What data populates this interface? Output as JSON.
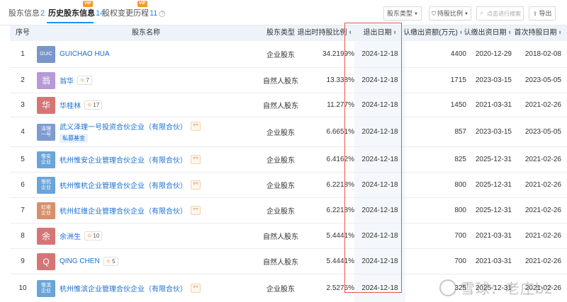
{
  "tabs": [
    {
      "label": "股东信息",
      "count": "2",
      "active": false,
      "vip": false
    },
    {
      "label": "历史股东信息",
      "count": "14",
      "active": true,
      "vip": true
    },
    {
      "label": "股权变更历程",
      "count": "11",
      "active": false,
      "vip": true
    }
  ],
  "vip_label": "VIP",
  "toolbar": {
    "shareholder_type": "股东类型",
    "holding_ratio": "持股比例",
    "search_placeholder": "点击进行搜索",
    "export": "导出"
  },
  "columns": {
    "idx": "序号",
    "name": "股东名称",
    "type": "股东类型",
    "ratio": "退出时持股比例",
    "exit_date": "退出日期",
    "amount": "认缴出资额(万元)",
    "sub_date": "认缴出资日期",
    "first_date": "首次持股日期"
  },
  "rows": [
    {
      "idx": "1",
      "avatar": "GUIC",
      "avatar_color": "#7a96c9",
      "avatar_size": "small",
      "name": "GUICHAO HUA",
      "holders": "",
      "org": false,
      "tag": "",
      "type": "企业股东",
      "ratio": "34.2199%",
      "exit_date": "2024-12-18",
      "amount": "4400",
      "sub_date": "2020-12-29",
      "first_date": "2018-02-08"
    },
    {
      "idx": "2",
      "avatar": "翁",
      "avatar_color": "#b59ad6",
      "avatar_size": "big",
      "name": "翁华",
      "holders": "7",
      "org": false,
      "tag": "",
      "type": "自然人股东",
      "ratio": "13.338%",
      "exit_date": "2024-12-18",
      "amount": "1715",
      "sub_date": "2023-03-15",
      "first_date": "2023-05-05"
    },
    {
      "idx": "3",
      "avatar": "华",
      "avatar_color": "#d57676",
      "avatar_size": "big",
      "name": "华桂林",
      "holders": "17",
      "org": false,
      "tag": "",
      "type": "自然人股东",
      "ratio": "11.277%",
      "exit_date": "2024-12-18",
      "amount": "1450",
      "sub_date": "2021-03-31",
      "first_date": "2021-02-26"
    },
    {
      "idx": "4",
      "avatar": "泽理\n一号",
      "avatar_color": "#7f9bcf",
      "avatar_size": "small",
      "name": "武义泽理一号投资合伙企业（有限合伙）",
      "holders": "",
      "org": true,
      "tag": "私募基金",
      "type": "企业股东",
      "ratio": "6.6651%",
      "exit_date": "2024-12-18",
      "amount": "857",
      "sub_date": "2023-03-15",
      "first_date": "2023-05-05"
    },
    {
      "idx": "5",
      "avatar": "惟安\n企业",
      "avatar_color": "#6aa4d8",
      "avatar_size": "small",
      "name": "杭州惟安企业管理合伙企业（有限合伙）",
      "holders": "",
      "org": true,
      "tag": "",
      "type": "企业股东",
      "ratio": "6.4162%",
      "exit_date": "2024-12-18",
      "amount": "825",
      "sub_date": "2025-12-31",
      "first_date": "2021-02-26"
    },
    {
      "idx": "6",
      "avatar": "惟杭\n企业",
      "avatar_color": "#6aa4d8",
      "avatar_size": "small",
      "name": "杭州惟杭企业管理合伙企业（有限合伙）",
      "holders": "",
      "org": true,
      "tag": "",
      "type": "企业股东",
      "ratio": "6.2218%",
      "exit_date": "2024-12-18",
      "amount": "800",
      "sub_date": "2025-12-31",
      "first_date": "2021-02-26"
    },
    {
      "idx": "7",
      "avatar": "虹维\n企业",
      "avatar_color": "#d68f6a",
      "avatar_size": "small",
      "name": "杭州虹维企业管理合伙企业（有限合伙）",
      "holders": "",
      "org": true,
      "tag": "",
      "type": "企业股东",
      "ratio": "6.2218%",
      "exit_date": "2024-12-18",
      "amount": "800",
      "sub_date": "2025-12-31",
      "first_date": "2021-02-26"
    },
    {
      "idx": "8",
      "avatar": "余",
      "avatar_color": "#d57676",
      "avatar_size": "big",
      "name": "余洲生",
      "holders": "10",
      "org": false,
      "tag": "",
      "type": "自然人股东",
      "ratio": "5.4441%",
      "exit_date": "2024-12-18",
      "amount": "700",
      "sub_date": "2021-03-31",
      "first_date": "2021-02-26"
    },
    {
      "idx": "9",
      "avatar": "Q",
      "avatar_color": "#d57676",
      "avatar_size": "big",
      "name": "QING CHEN",
      "holders": "5",
      "org": false,
      "tag": "",
      "type": "自然人股东",
      "ratio": "5.4441%",
      "exit_date": "2024-12-18",
      "amount": "700",
      "sub_date": "2021-03-31",
      "first_date": "2021-02-26"
    },
    {
      "idx": "10",
      "avatar": "惟滨\n企业",
      "avatar_color": "#6aa4d8",
      "avatar_size": "small",
      "name": "杭州惟滨企业管理合伙企业（有限合伙）",
      "holders": "",
      "org": true,
      "tag": "",
      "type": "企业股东",
      "ratio": "2.5276%",
      "exit_date": "2024-12-18",
      "amount": "325",
      "sub_date": "2025-12-31",
      "first_date": "2021-02-26"
    }
  ],
  "org_badge_glyph": "⺳",
  "watermark": "雪球：老庄bz"
}
